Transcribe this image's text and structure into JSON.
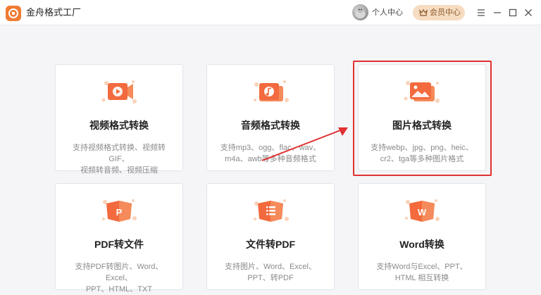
{
  "app": {
    "title": "金舟格式工厂",
    "logo_icon": "app-logo-icon"
  },
  "header": {
    "user_center_label": "个人中心",
    "member_center_label": "会员中心",
    "member_icon": "crown-icon",
    "controls": [
      "menu-icon",
      "minimize-icon",
      "maximize-icon",
      "close-icon"
    ]
  },
  "colors": {
    "accent": "#f07b33",
    "highlight_border": "#e03030",
    "member_bg": "#f6dcc1"
  },
  "cards": [
    {
      "title": "视频格式转换",
      "desc_line1": "支持视频格式转换、视频转GIF、",
      "desc_line2": "视频转音频、视频压缩",
      "icon": "video-icon"
    },
    {
      "title": "音频格式转换",
      "desc_line1": "支持mp3、ogg、flac、wav、",
      "desc_line2": "m4a、awb等多种音频格式",
      "icon": "music-icon"
    },
    {
      "title": "图片格式转换",
      "desc_line1": "支持webp、jpg、png、heic、",
      "desc_line2": "cr2、tga等多种图片格式",
      "icon": "image-icon"
    },
    {
      "title": "PDF转文件",
      "desc_line1": "支持PDF转图片、Word、Excel、",
      "desc_line2": "PPT、HTML、TXT",
      "icon": "pdf-icon"
    },
    {
      "title": "文件转PDF",
      "desc_line1": "支持图片、Word、Excel、",
      "desc_line2": "PPT、转PDF",
      "icon": "document-icon"
    },
    {
      "title": "Word转换",
      "desc_line1": "支持Word与Excel、PPT、",
      "desc_line2": "HTML 相互转换",
      "icon": "word-icon"
    }
  ],
  "icon_letters": {
    "pdf": "P",
    "word": "W"
  }
}
